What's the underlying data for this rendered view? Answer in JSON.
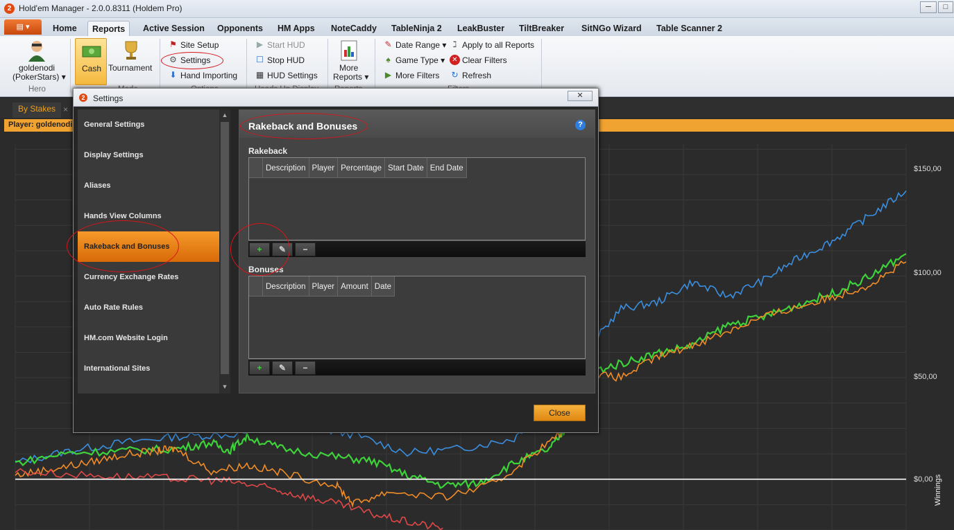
{
  "window": {
    "app_icon": "2",
    "title": "Hold'em Manager - 2.0.0.8311 (Holdem Pro)",
    "controls": [
      "─",
      "□",
      "✕"
    ]
  },
  "ribbon_tabs": [
    {
      "label": "Home",
      "active": false
    },
    {
      "label": "Reports",
      "active": true
    },
    {
      "label": "Active Session",
      "active": false
    },
    {
      "label": "Opponents",
      "active": false
    },
    {
      "label": "HM Apps",
      "active": false
    },
    {
      "label": "NoteCaddy",
      "active": false
    },
    {
      "label": "TableNinja 2",
      "active": false
    },
    {
      "label": "LeakBuster",
      "active": false
    },
    {
      "label": "TiltBreaker",
      "active": false
    },
    {
      "label": "SitNGo Wizard",
      "active": false
    },
    {
      "label": "Table Scanner 2",
      "active": false
    }
  ],
  "ribbon": {
    "hero": {
      "name": "goldenodi",
      "site": "(PokerStars)",
      "group": "Hero"
    },
    "mode": {
      "cash": "Cash",
      "tournament": "Tournament",
      "group": "Mode"
    },
    "options": {
      "site_setup": "Site Setup",
      "settings": "Settings",
      "hand_importing": "Hand Importing",
      "group": "Options"
    },
    "hud": {
      "start": "Start HUD",
      "stop": "Stop HUD",
      "settings": "HUD Settings",
      "group": "Heads Up Display"
    },
    "reports": {
      "more": "More",
      "reports": "Reports",
      "group": "Reports"
    },
    "filters": {
      "date_range": "Date Range",
      "game_type": "Game Type",
      "more_filters": "More Filters",
      "apply_all": "Apply to all Reports",
      "clear": "Clear Filters",
      "refresh": "Refresh",
      "group": "Filters"
    }
  },
  "doc_tab": {
    "label": "By Stakes",
    "close": "×"
  },
  "player_bar": "Player: goldenodi (P",
  "chart_data": {
    "type": "line",
    "ylabel": "Winnings",
    "ytick_labels": [
      "$150,00",
      "$100,00",
      "$50,00",
      "$0,00"
    ],
    "ylim": [
      -25,
      165
    ],
    "yticks": [
      150,
      100,
      50,
      0
    ],
    "grid": true,
    "series": [
      {
        "color": "#3a8fe0",
        "x": [
          0,
          6,
          12,
          18,
          24,
          32,
          38,
          44,
          50,
          56,
          60,
          64,
          68,
          72,
          76,
          80,
          84,
          88,
          92,
          96,
          100
        ],
        "values": [
          8,
          14,
          18,
          21,
          22,
          26,
          22,
          13,
          15,
          20,
          40,
          63,
          84,
          87,
          97,
          90,
          98,
          109,
          118,
          130,
          142
        ]
      },
      {
        "color": "#3ed23a",
        "x": [
          0,
          6,
          12,
          18,
          22,
          24,
          26,
          30,
          36,
          40,
          44,
          48,
          52,
          56,
          60,
          62,
          64,
          68,
          72,
          76,
          80,
          84,
          88,
          92,
          96,
          100
        ],
        "values": [
          8,
          13,
          14,
          15,
          18,
          14,
          21,
          15,
          11,
          9,
          2,
          -3,
          -2,
          8,
          15,
          26,
          52,
          57,
          62,
          66,
          76,
          80,
          86,
          92,
          100,
          111
        ]
      },
      {
        "color": "#f08c28",
        "x": [
          0,
          4,
          8,
          12,
          16,
          18,
          22,
          26,
          30,
          36,
          38,
          42,
          48,
          54,
          58,
          62,
          64,
          68,
          72,
          76,
          80,
          84,
          88,
          92,
          96,
          100
        ],
        "values": [
          2,
          5,
          8,
          12,
          14,
          15,
          4,
          7,
          3,
          -3,
          -12,
          -6,
          -9,
          -2,
          12,
          25,
          52,
          50,
          60,
          66,
          73,
          80,
          85,
          90,
          96,
          107
        ]
      },
      {
        "color": "#e04848",
        "x": [
          0,
          8,
          14,
          20,
          24,
          28,
          32,
          36,
          40,
          44,
          48
        ],
        "values": [
          4,
          2,
          1,
          0,
          -1,
          -4,
          -8,
          -12,
          -17,
          -21,
          -24
        ]
      },
      {
        "color": "#ffffff",
        "x": [
          0,
          100
        ],
        "values": [
          0,
          0
        ]
      }
    ]
  },
  "dialog": {
    "icon": "2",
    "title": "Settings",
    "close": "✕",
    "nav_items": [
      {
        "label": "General Settings",
        "active": false
      },
      {
        "label": "Display Settings",
        "active": false
      },
      {
        "label": "Aliases",
        "active": false
      },
      {
        "label": "Hands View Columns",
        "active": false
      },
      {
        "label": "Rakeback and Bonuses",
        "active": true
      },
      {
        "label": "Currency Exchange Rates",
        "active": false
      },
      {
        "label": "Auto Rate Rules",
        "active": false
      },
      {
        "label": "HM.com Website Login",
        "active": false
      },
      {
        "label": "International Sites",
        "active": false
      }
    ],
    "heading": "Rakeback and Bonuses",
    "help": "?",
    "rakeback": {
      "label": "Rakeback",
      "columns": [
        "Description",
        "Player",
        "Percentage",
        "Start Date",
        "End Date"
      ]
    },
    "bonuses": {
      "label": "Bonuses",
      "columns": [
        "Description",
        "Player",
        "Amount",
        "Date"
      ]
    },
    "buttons": {
      "add": "+",
      "edit": "✎",
      "remove": "−"
    },
    "close_button": "Close"
  }
}
